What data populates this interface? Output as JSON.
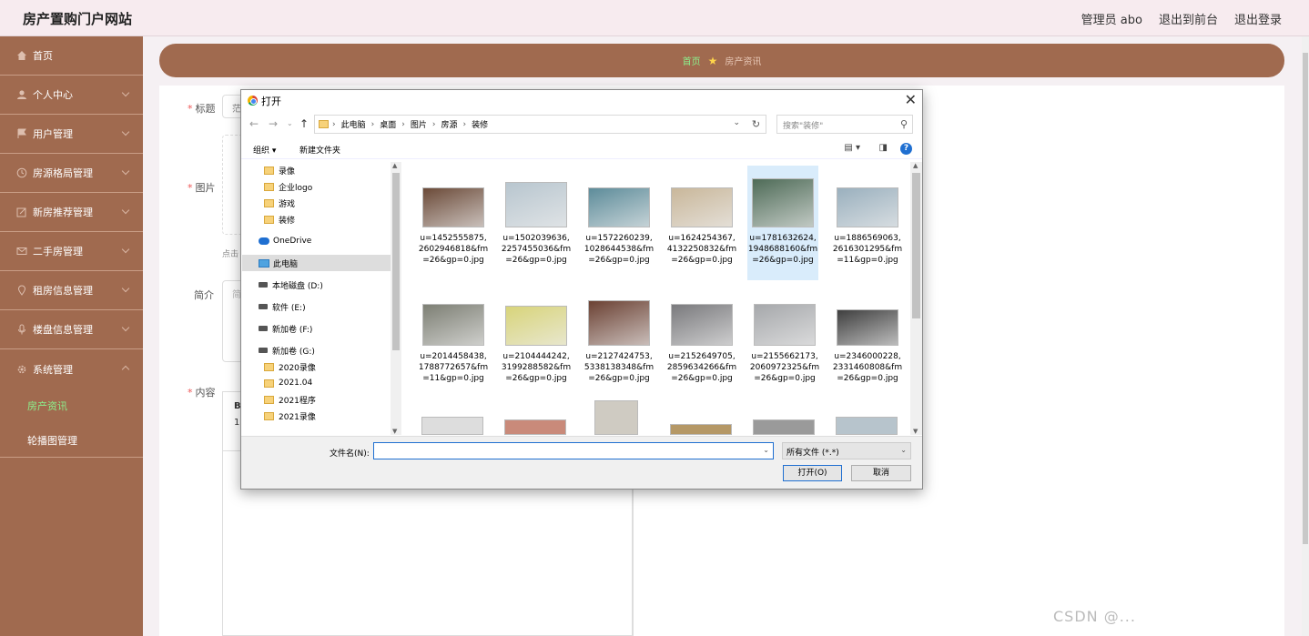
{
  "header": {
    "site_title": "房产置购门户网站",
    "admin_label": "管理员 abo",
    "front_link": "退出到前台",
    "logout_link": "退出登录"
  },
  "sidebar": {
    "items": [
      {
        "label": "首页",
        "icon": "home-icon"
      },
      {
        "label": "个人中心",
        "icon": "user-icon"
      },
      {
        "label": "用户管理",
        "icon": "flag-icon"
      },
      {
        "label": "房源格局管理",
        "icon": "clock-icon"
      },
      {
        "label": "新房推荐管理",
        "icon": "edit-icon"
      },
      {
        "label": "二手房管理",
        "icon": "mail-icon"
      },
      {
        "label": "租房信息管理",
        "icon": "pin-icon"
      },
      {
        "label": "楼盘信息管理",
        "icon": "mic-icon"
      },
      {
        "label": "系统管理",
        "icon": "gear-icon"
      }
    ],
    "sub_items": [
      {
        "label": "房产资讯",
        "active": true
      },
      {
        "label": "轮播图管理",
        "active": false
      }
    ]
  },
  "breadcrumb": {
    "home": "首页",
    "current": "房产资讯"
  },
  "form": {
    "title_label": "标题",
    "title_value": "茫",
    "image_label": "图片",
    "image_hint": "点击",
    "intro_label": "简介",
    "intro_placeholder": "简",
    "content_label": "内容",
    "editor_frag1": "B",
    "editor_frag2": "1"
  },
  "watermark": "CSDN @...",
  "dialog": {
    "title": "打开",
    "close": "✕",
    "path": [
      "此电脑",
      "桌面",
      "图片",
      "房源",
      "装修"
    ],
    "search_placeholder": "搜索\"装修\"",
    "toolbar": {
      "organize": "组织 ▾",
      "new_folder": "新建文件夹"
    },
    "tree": [
      {
        "label": "录像",
        "type": "folder",
        "indent": 1
      },
      {
        "label": "企业logo",
        "type": "folder",
        "indent": 1
      },
      {
        "label": "游戏",
        "type": "folder",
        "indent": 1
      },
      {
        "label": "装修",
        "type": "folder",
        "indent": 1
      },
      {
        "label": "OneDrive",
        "type": "onedrive",
        "indent": 0
      },
      {
        "label": "此电脑",
        "type": "pc",
        "indent": 0,
        "selected": true
      },
      {
        "label": "本地磁盘 (D:)",
        "type": "drive",
        "indent": 0
      },
      {
        "label": "软件 (E:)",
        "type": "drive",
        "indent": 0
      },
      {
        "label": "新加卷 (F:)",
        "type": "drive",
        "indent": 0
      },
      {
        "label": "新加卷 (G:)",
        "type": "drive",
        "indent": 0
      },
      {
        "label": "2020录像",
        "type": "folder",
        "indent": 1
      },
      {
        "label": "2021.04",
        "type": "folder",
        "indent": 1
      },
      {
        "label": "2021程序",
        "type": "folder",
        "indent": 1
      },
      {
        "label": "2021录像",
        "type": "folder",
        "indent": 1
      }
    ],
    "files": [
      {
        "name": "u=1452555875,2602946818&fm=26&gp=0.jpg",
        "color": "#6b4a38"
      },
      {
        "name": "u=1502039636,2257455036&fm=26&gp=0.jpg",
        "color": "#b8c6cf"
      },
      {
        "name": "u=1572260239,1028644538&fm=26&gp=0.jpg",
        "color": "#5d8c9a"
      },
      {
        "name": "u=1624254367,4132250832&fm=26&gp=0.jpg",
        "color": "#c9b79a"
      },
      {
        "name": "u=1781632624,1948688160&fm=26&gp=0.jpg",
        "color": "#4e6b57",
        "selected": true
      },
      {
        "name": "u=1886569063,2616301295&fm=11&gp=0.jpg",
        "color": "#9ab0be"
      },
      {
        "name": "u=2014458438,1788772657&fm=11&gp=0.jpg",
        "color": "#7d7f74"
      },
      {
        "name": "u=2104444242,3199288582&fm=26&gp=0.jpg",
        "color": "#d8d47a"
      },
      {
        "name": "u=2127424753,5338138348&fm=26&gp=0.jpg",
        "color": "#6b4133"
      },
      {
        "name": "u=2152649705,2859634266&fm=26&gp=0.jpg",
        "color": "#7a7a7d"
      },
      {
        "name": "u=2155662173,2060972325&fm=26&gp=0.jpg",
        "color": "#a6a8ab"
      },
      {
        "name": "u=2346000228,2331460808&fm=26&gp=0.jpg",
        "color": "#3f3f3f"
      }
    ],
    "filename_label": "文件名(N):",
    "filename_value": "",
    "filetype": "所有文件 (*.*)",
    "open_button": "打开(O)",
    "cancel_button": "取消"
  }
}
